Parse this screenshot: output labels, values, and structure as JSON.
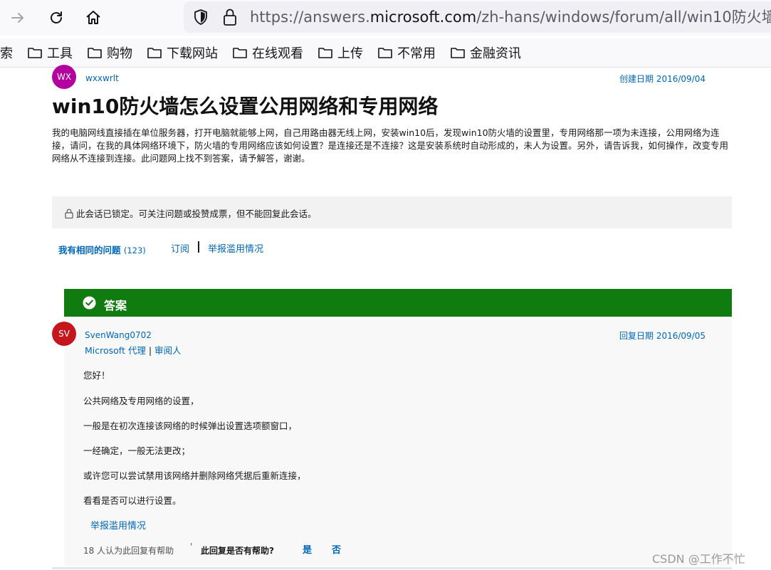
{
  "browser": {
    "url_prefix": "https://answers.",
    "url_host": "microsoft.com",
    "url_path": "/zh-hans/windows/forum/all/win10防火墙怎",
    "bookmarks": [
      "索",
      "工具",
      "购物",
      "下载网站",
      "在线观看",
      "上传",
      "不常用",
      "金融资讯"
    ]
  },
  "question": {
    "author_initials": "WX",
    "author_color": "#b4009e",
    "author": "wxxwrlt",
    "created_label": "创建日期",
    "created_date": "2016/09/04",
    "title": "win10防火墙怎么设置公用网络和专用网络",
    "body": "我的电脑网线直接插在单位服务器，打开电脑就能够上网，自己用路由器无线上网，安装win10后，发现win10防火墙的设置里，专用网络那一项为未连接，公用网络为连接，请问，在我的具体网络环境下，防火墙的专用网络应该如何设置？是连接还是不连接？这是安装系统时自动形成的，未人为设置。另外，请告诉我，如何操作，改变专用网络从不连接到连接。此问题网上找不到答案，请予解答，谢谢。"
  },
  "locked": {
    "text": "此会话已锁定。可关注问题或投赞成票，但不能回复此会话。"
  },
  "actions": {
    "same_question": "我有相同的问题",
    "same_count": "(123)",
    "subscribe": "订阅",
    "report": "举报滥用情况"
  },
  "answer": {
    "header": "答案",
    "author_initials": "SV",
    "author_color": "#c4161c",
    "author": "SvenWang0702",
    "role": "Microsoft 代理",
    "role2": "审阅人",
    "reply_label": "回复日期",
    "reply_date": "2016/09/05",
    "lines": [
      "您好！",
      "公共网络及专用网络的设置，",
      "一般是在初次连接该网络的时候弹出设置选项额窗口，",
      "一经确定，一般无法更改；",
      "或许您可以尝试禁用该网络并删除网络凭据后重新连接，",
      "看看是否可以进行设置。"
    ],
    "report": "举报滥用情况",
    "helpful_count": "18 人认为此回复有帮助",
    "helpful_question": "此回复是否有帮助?",
    "yes": "是",
    "no": "否"
  },
  "watermark": "CSDN @工作不忙",
  "colors": {
    "link": "#0067b8",
    "answer_green": "#107c10"
  }
}
